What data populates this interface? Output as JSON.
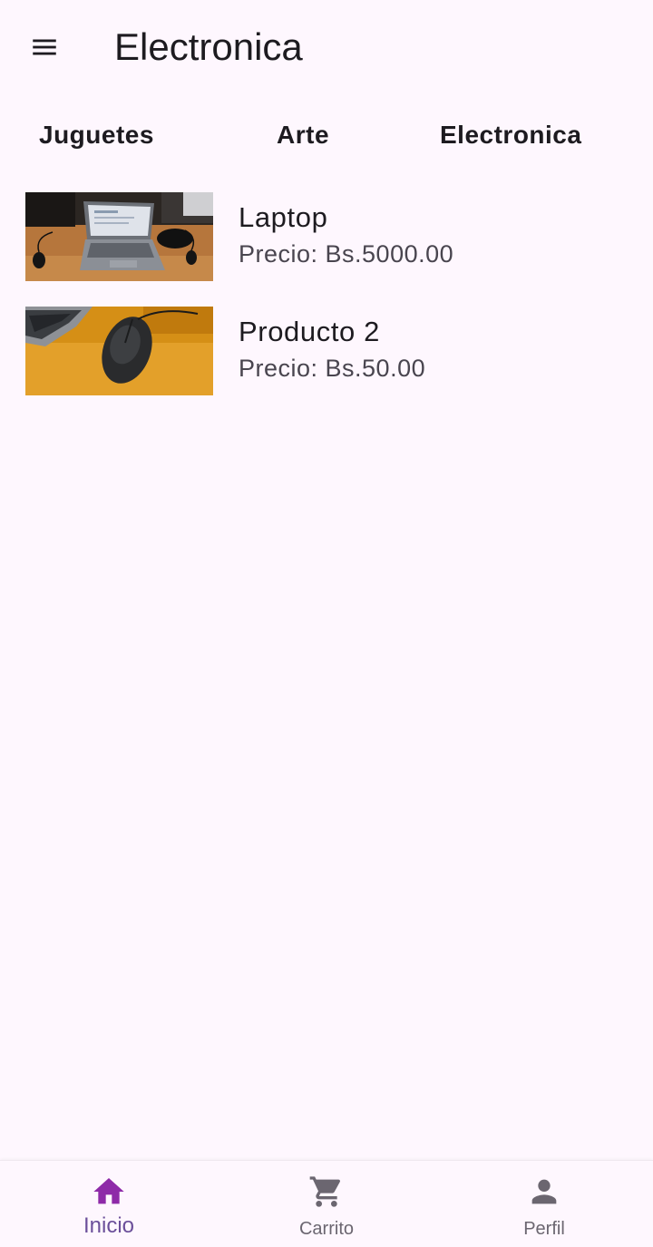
{
  "app_bar": {
    "title": "Electronica",
    "menu_icon": "menu-icon"
  },
  "categories": [
    {
      "label": "Juguetes"
    },
    {
      "label": "Arte"
    },
    {
      "label": "Electronica"
    }
  ],
  "products": [
    {
      "name": "Laptop",
      "price": "Precio: Bs.5000.00",
      "image": "laptop-photo"
    },
    {
      "name": "Producto 2",
      "price": "Precio: Bs.50.00",
      "image": "mouse-photo"
    }
  ],
  "bottom_nav": {
    "items": [
      {
        "label": "Inicio",
        "icon": "home-icon",
        "active": true
      },
      {
        "label": "Carrito",
        "icon": "cart-icon",
        "active": false
      },
      {
        "label": "Perfil",
        "icon": "person-icon",
        "active": false
      }
    ]
  },
  "colors": {
    "background": "#fef7fe",
    "active_icon": "#8e2aa8",
    "active_label": "#6b4f9a",
    "inactive": "#6b6670"
  }
}
